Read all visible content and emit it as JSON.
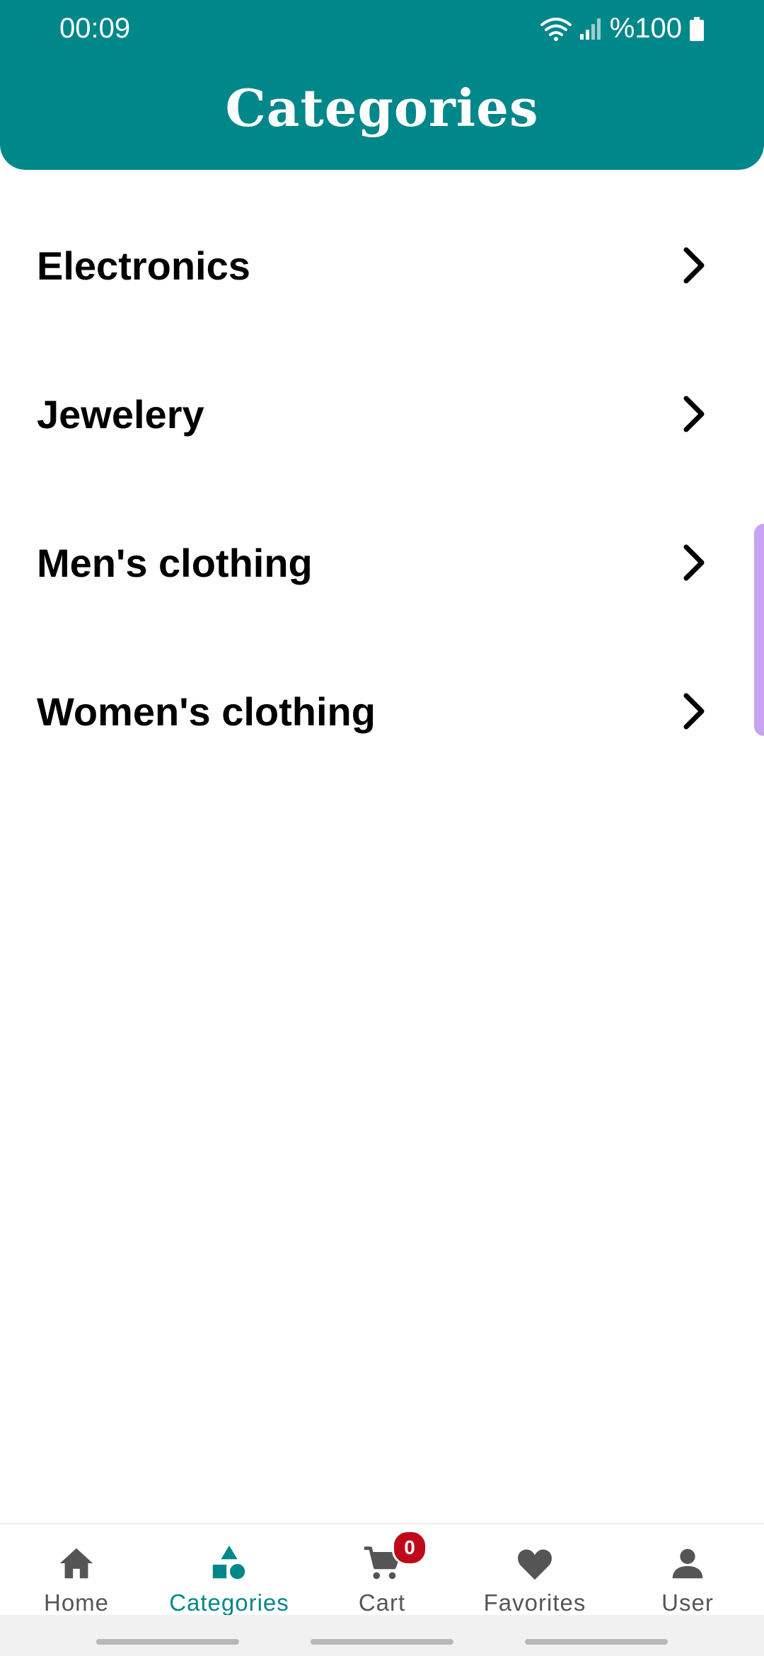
{
  "status_bar": {
    "time": "00:09",
    "battery": "%100"
  },
  "header": {
    "title": "Categories",
    "background_color": "#00878a"
  },
  "categories": [
    {
      "label": "Electronics"
    },
    {
      "label": "Jewelery"
    },
    {
      "label": "Men's clothing"
    },
    {
      "label": "Women's clothing"
    }
  ],
  "bottom_nav": {
    "items": [
      {
        "label": "Home",
        "icon": "home-icon",
        "active": false
      },
      {
        "label": "Categories",
        "icon": "categories-icon",
        "active": true
      },
      {
        "label": "Cart",
        "icon": "cart-icon",
        "active": false
      },
      {
        "label": "Favorites",
        "icon": "heart-icon",
        "active": false
      },
      {
        "label": "User",
        "icon": "user-icon",
        "active": false
      }
    ],
    "cart_badge": "0",
    "active_color": "#00878a",
    "badge_color": "#c0081c"
  }
}
